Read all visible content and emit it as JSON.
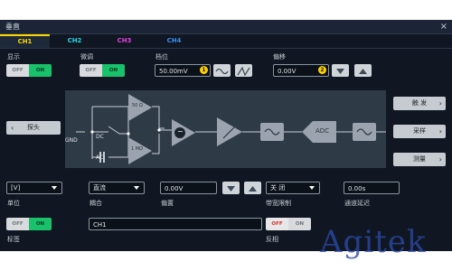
{
  "window": {
    "title": "垂直",
    "close": "×"
  },
  "tabs": [
    {
      "label": "CH1",
      "color": "#ffd500",
      "active": true
    },
    {
      "label": "CH2",
      "color": "#22d3e6",
      "active": false
    },
    {
      "label": "CH3",
      "color": "#e23ee0",
      "active": false
    },
    {
      "label": "CH4",
      "color": "#3a8df0",
      "active": false
    }
  ],
  "display": {
    "label": "显示",
    "off": "OFF",
    "on": "ON",
    "state": "ON"
  },
  "fine": {
    "label": "微调",
    "off": "OFF",
    "on": "ON",
    "state": "ON"
  },
  "scale": {
    "label": "档位",
    "value": "50.00mV",
    "knob": "1"
  },
  "offset": {
    "label": "偏移",
    "value": "0.00V",
    "knob": "2"
  },
  "probe": {
    "label": "探头",
    "chevron": "‹"
  },
  "diagram": {
    "gnd": "GND",
    "dc": "DC",
    "ac": "AC",
    "r50": "50 Ω",
    "r1m": "1 MΩ",
    "minus": "−",
    "adc": "ADC"
  },
  "side_buttons": [
    {
      "label": "触 发",
      "chevron": "›"
    },
    {
      "label": "采样",
      "chevron": "›"
    },
    {
      "label": "测量",
      "chevron": "›"
    }
  ],
  "unit": {
    "label": "单位",
    "value": "[V]"
  },
  "coupling": {
    "label": "耦合",
    "value": "直流"
  },
  "bias": {
    "label": "偏置",
    "value": "0.00V"
  },
  "bandwidth": {
    "label": "带宽限制",
    "value": "关 闭"
  },
  "delay": {
    "label": "通道延迟",
    "value": "0.00s"
  },
  "tag": {
    "label": "标签",
    "off": "OFF",
    "on": "ON",
    "state": "ON",
    "text": "CH1"
  },
  "invert": {
    "label": "反相",
    "off": "OFF",
    "on": "ON",
    "state": "OFF"
  },
  "watermark": "Agitek",
  "colors": {
    "accent": "#ffd500",
    "on": "#19c16a",
    "panel": "#101722"
  }
}
